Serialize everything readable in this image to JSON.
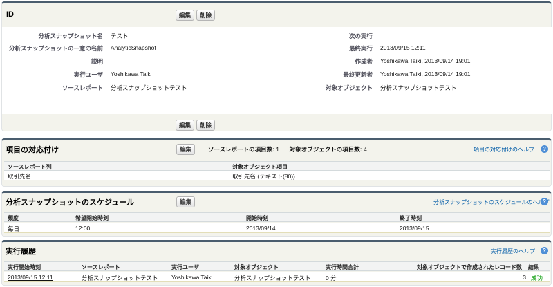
{
  "detail": {
    "title": "ID",
    "edit_label": "編集",
    "delete_label": "削除",
    "fields_left": [
      {
        "label": "分析スナップショット名",
        "value": "テスト",
        "link": false
      },
      {
        "label": "分析スナップショットの一意の名前",
        "value": "AnalyticSnapshot",
        "link": false
      },
      {
        "label": "説明",
        "value": "",
        "link": false
      },
      {
        "label": "実行ユーザ",
        "value": "Yoshikawa Taiki",
        "link": true
      },
      {
        "label": "ソースレポート",
        "value": "分析スナップショットテスト",
        "link": true
      }
    ],
    "fields_right": [
      {
        "label": "次の実行",
        "value": "",
        "link": false
      },
      {
        "label": "最終実行",
        "value": "2013/09/15 12:11",
        "link": false
      },
      {
        "label": "作成者",
        "value": "Yoshikawa Taiki",
        "suffix": ", 2013/09/14 19:01",
        "link": true
      },
      {
        "label": "最終更新者",
        "value": "Yoshikawa Taiki",
        "suffix": ", 2013/09/14 19:01",
        "link": true
      },
      {
        "label": "対象オブジェクト",
        "value": "分析スナップショットテスト",
        "link": true
      }
    ]
  },
  "mapping": {
    "title": "項目の対応付け",
    "edit_label": "編集",
    "source_count_label": "ソースレポートの項目数:",
    "source_count": "1",
    "target_count_label": "対象オブジェクトの項目数:",
    "target_count": "4",
    "help": "項目の対応付けのヘルプ",
    "help_icon": "?",
    "columns": [
      "ソースレポート列",
      "対象オブジェクト項目"
    ],
    "rows": [
      [
        "取引先名",
        "取引先名 (テキスト(80))"
      ]
    ]
  },
  "schedule": {
    "title": "分析スナップショットのスケジュール",
    "edit_label": "編集",
    "help": "分析スナップショットのスケジュールのヘルプ",
    "help_icon": "?",
    "columns": [
      "頻度",
      "希望開始時刻",
      "開始時刻",
      "終了時刻"
    ],
    "rows": [
      [
        "毎日",
        "12:00",
        "2013/09/14",
        "2013/09/15"
      ]
    ]
  },
  "history": {
    "title": "実行履歴",
    "help": "実行履歴のヘルプ",
    "help_icon": "?",
    "columns": [
      "実行開始時刻",
      "ソースレポート",
      "実行ユーザ",
      "対象オブジェクト",
      "実行時間合計",
      "対象オブジェクトで作成されたレコード数",
      "結果"
    ],
    "rows": [
      [
        "2013/09/15 12:11",
        "分析スナップショットテスト",
        "Yoshikawa Taiki",
        "分析スナップショットテスト",
        "0 分",
        "3",
        "成功"
      ]
    ]
  },
  "colors": {
    "accent_bar": "#4a5d6e",
    "help_link": "#015ba7",
    "success": "#009900",
    "help_icon": "#4f8fd6"
  }
}
